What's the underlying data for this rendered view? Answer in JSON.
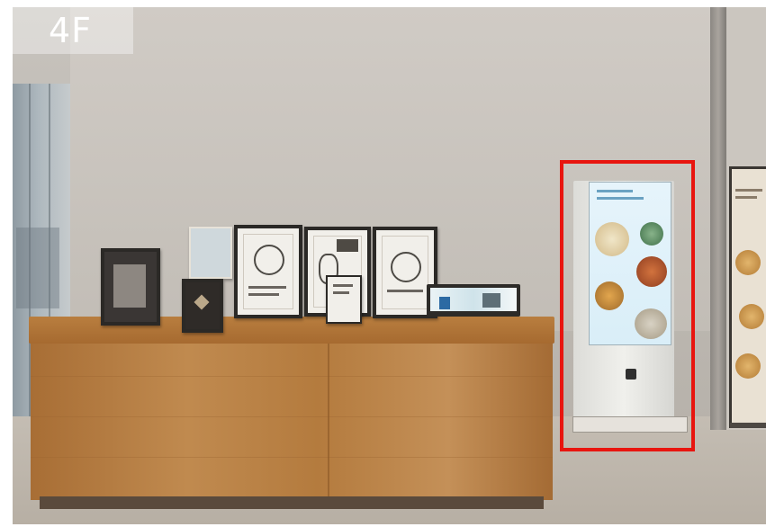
{
  "photo": {
    "floor_label": "4F"
  },
  "annotation": {
    "highlight_color": "#e8150f"
  },
  "colors": {
    "wall": "#c7c3bd",
    "counter_wood": "#b47b3e"
  }
}
